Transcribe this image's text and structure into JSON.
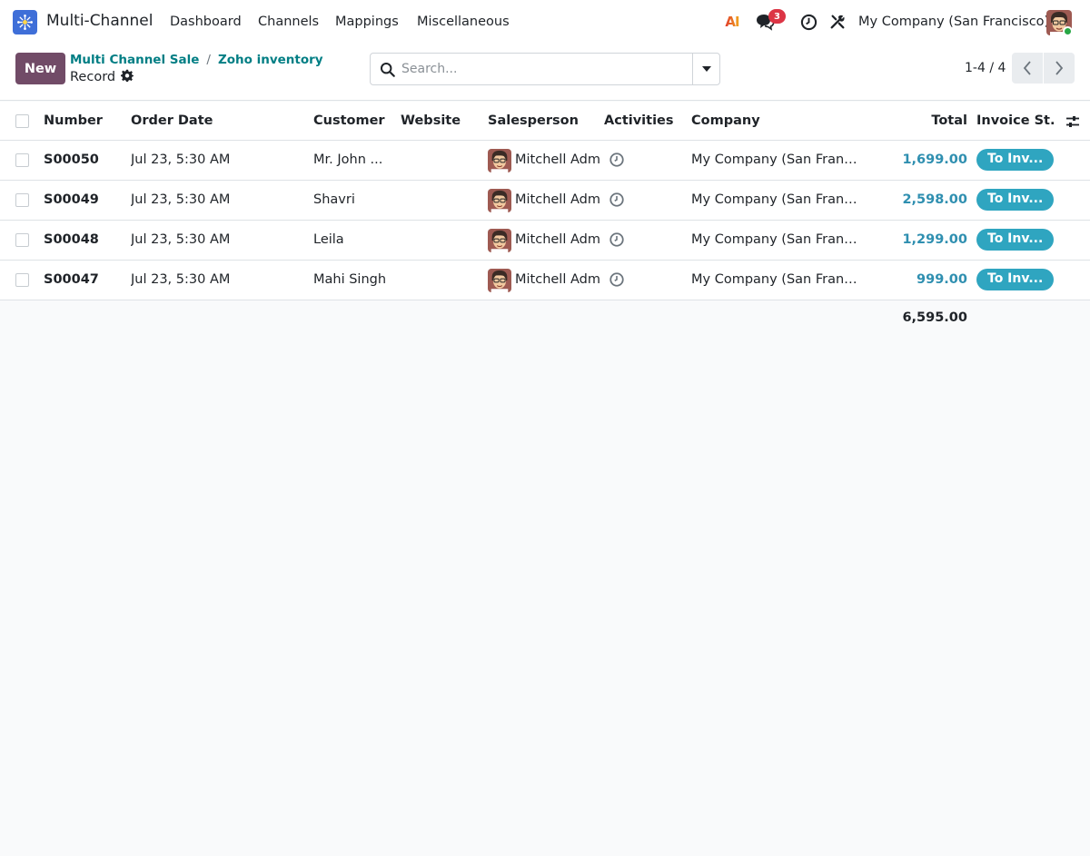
{
  "app": {
    "name": "Multi-Channel"
  },
  "menu": [
    "Dashboard",
    "Channels",
    "Mappings",
    "Miscellaneous"
  ],
  "systray": {
    "ai_label": "AI",
    "messages_count": "3",
    "company": "My Company (San Francisco)"
  },
  "control": {
    "new_label": "New",
    "breadcrumbs": [
      "Multi Channel Sale",
      "Zoho inventory"
    ],
    "breadcrumb_sep": "/",
    "record_title": "Record",
    "search_placeholder": "Search...",
    "pager": "1-4 / 4"
  },
  "table": {
    "columns": [
      "Number",
      "Order Date",
      "Customer",
      "Website",
      "Salesperson",
      "Activities",
      "Company",
      "Total",
      "Invoice St..."
    ],
    "rows": [
      {
        "number": "S00050",
        "date": "Jul 23, 5:30 AM",
        "customer": "Mr. John ...",
        "website": "",
        "salesperson": "Mitchell Admi",
        "company": "My Company (San Franci...",
        "total": "1,699.00",
        "status": "To Inv..."
      },
      {
        "number": "S00049",
        "date": "Jul 23, 5:30 AM",
        "customer": "Shavri",
        "website": "",
        "salesperson": "Mitchell Admi",
        "company": "My Company (San Franci...",
        "total": "2,598.00",
        "status": "To Inv..."
      },
      {
        "number": "S00048",
        "date": "Jul 23, 5:30 AM",
        "customer": "Leila",
        "website": "",
        "salesperson": "Mitchell Admi",
        "company": "My Company (San Franci...",
        "total": "1,299.00",
        "status": "To Inv..."
      },
      {
        "number": "S00047",
        "date": "Jul 23, 5:30 AM",
        "customer": "Mahi Singh",
        "website": "",
        "salesperson": "Mitchell Admi",
        "company": "My Company (San Franci...",
        "total": "999.00",
        "status": "To Inv..."
      }
    ],
    "grand_total": "6,595.00"
  },
  "colors": {
    "brand": "#714b67",
    "link": "#017e84",
    "status_pill": "#2fa5c0",
    "badge": "#dc3545"
  }
}
